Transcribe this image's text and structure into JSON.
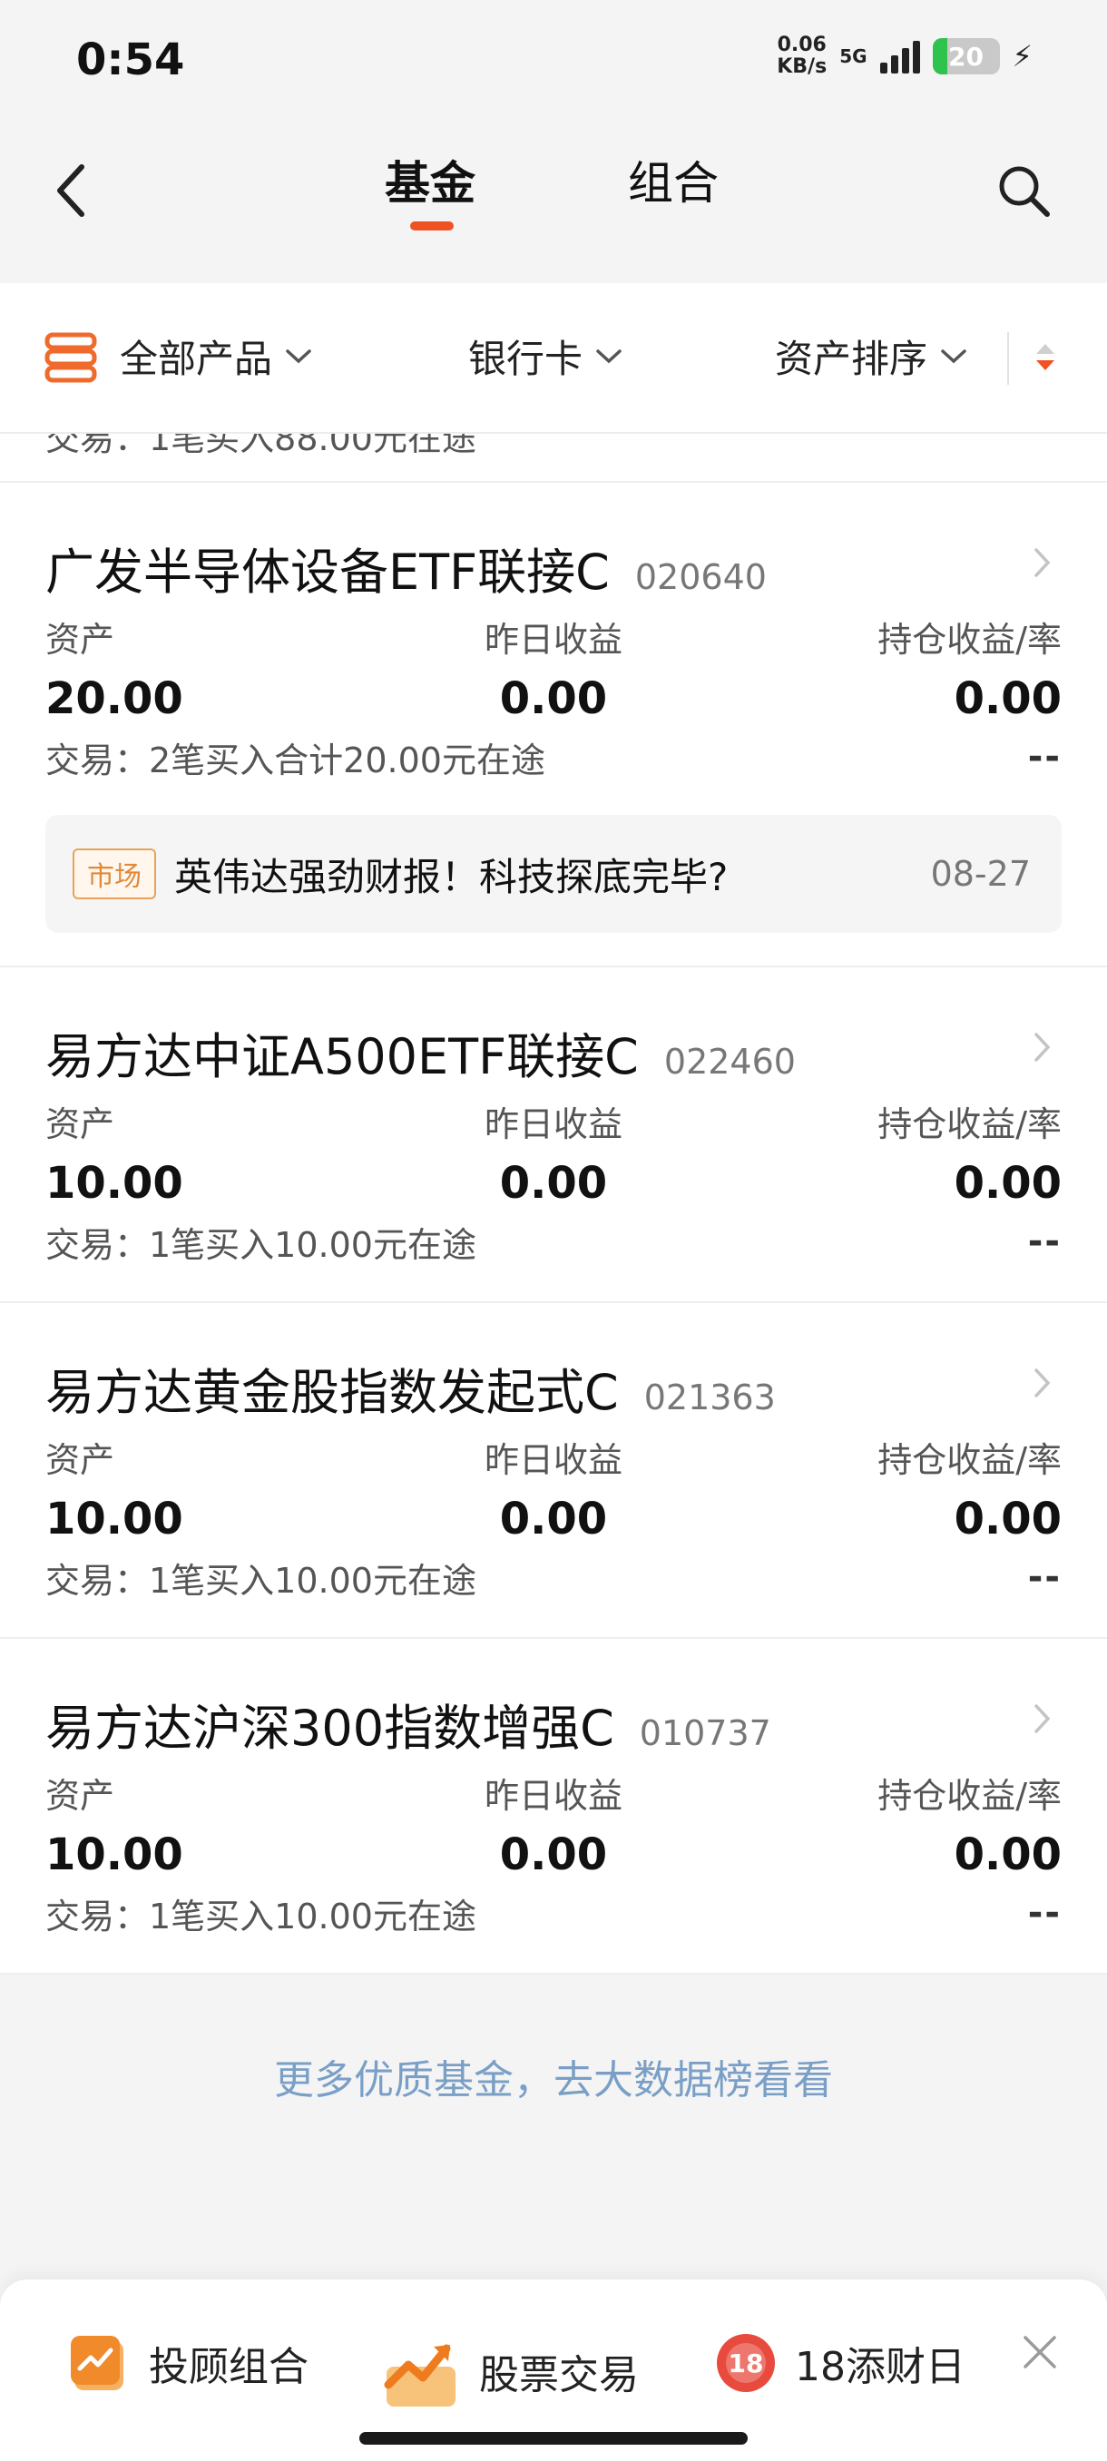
{
  "status": {
    "time": "0:54",
    "net_speed_value": "0.06",
    "net_speed_unit": "KB/s",
    "network": "5G",
    "battery": "20",
    "colors": {
      "battery_fill": "#2fc24d"
    }
  },
  "nav": {
    "back_icon": "chevron-left-icon",
    "tabs": [
      {
        "label": "基金",
        "active": true
      },
      {
        "label": "组合",
        "active": false
      }
    ],
    "search_icon": "search-icon",
    "accent": "#ef5324"
  },
  "filters": {
    "all_products": "全部产品",
    "bank_card": "银行卡",
    "asset_sort": "资产排序"
  },
  "clipped_row_text": "交易：1笔买入88.00元在途",
  "funds": [
    {
      "name": "广发半导体设备ETF联接C",
      "code": "020640",
      "asset_label": "资产",
      "yesterday_label": "昨日收益",
      "hold_label": "持仓收益/率",
      "asset": "20.00",
      "yesterday": "0.00",
      "hold": "0.00",
      "trade": "交易：2笔买入合计20.00元在途",
      "hold_rate": "--",
      "news": {
        "tag": "市场",
        "text": "英伟达强劲财报！科技探底完毕?",
        "date": "08-27"
      }
    },
    {
      "name": "易方达中证A500ETF联接C",
      "code": "022460",
      "asset_label": "资产",
      "yesterday_label": "昨日收益",
      "hold_label": "持仓收益/率",
      "asset": "10.00",
      "yesterday": "0.00",
      "hold": "0.00",
      "trade": "交易：1笔买入10.00元在途",
      "hold_rate": "--"
    },
    {
      "name": "易方达黄金股指数发起式C",
      "code": "021363",
      "asset_label": "资产",
      "yesterday_label": "昨日收益",
      "hold_label": "持仓收益/率",
      "asset": "10.00",
      "yesterday": "0.00",
      "hold": "0.00",
      "trade": "交易：1笔买入10.00元在途",
      "hold_rate": "--"
    },
    {
      "name": "易方达沪深300指数增强C",
      "code": "010737",
      "asset_label": "资产",
      "yesterday_label": "昨日收益",
      "hold_label": "持仓收益/率",
      "asset": "10.00",
      "yesterday": "0.00",
      "hold": "0.00",
      "trade": "交易：1笔买入10.00元在途",
      "hold_rate": "--"
    }
  ],
  "more_link": "更多优质基金，去大数据榜看看",
  "bottom_bar": {
    "items": [
      {
        "label": "投顾组合",
        "icon": "portfolio-chart-icon"
      },
      {
        "label": "股票交易",
        "icon": "stock-trend-icon"
      },
      {
        "label": "18添财日",
        "icon": "badge-18-icon"
      }
    ],
    "close_icon": "close-icon"
  }
}
